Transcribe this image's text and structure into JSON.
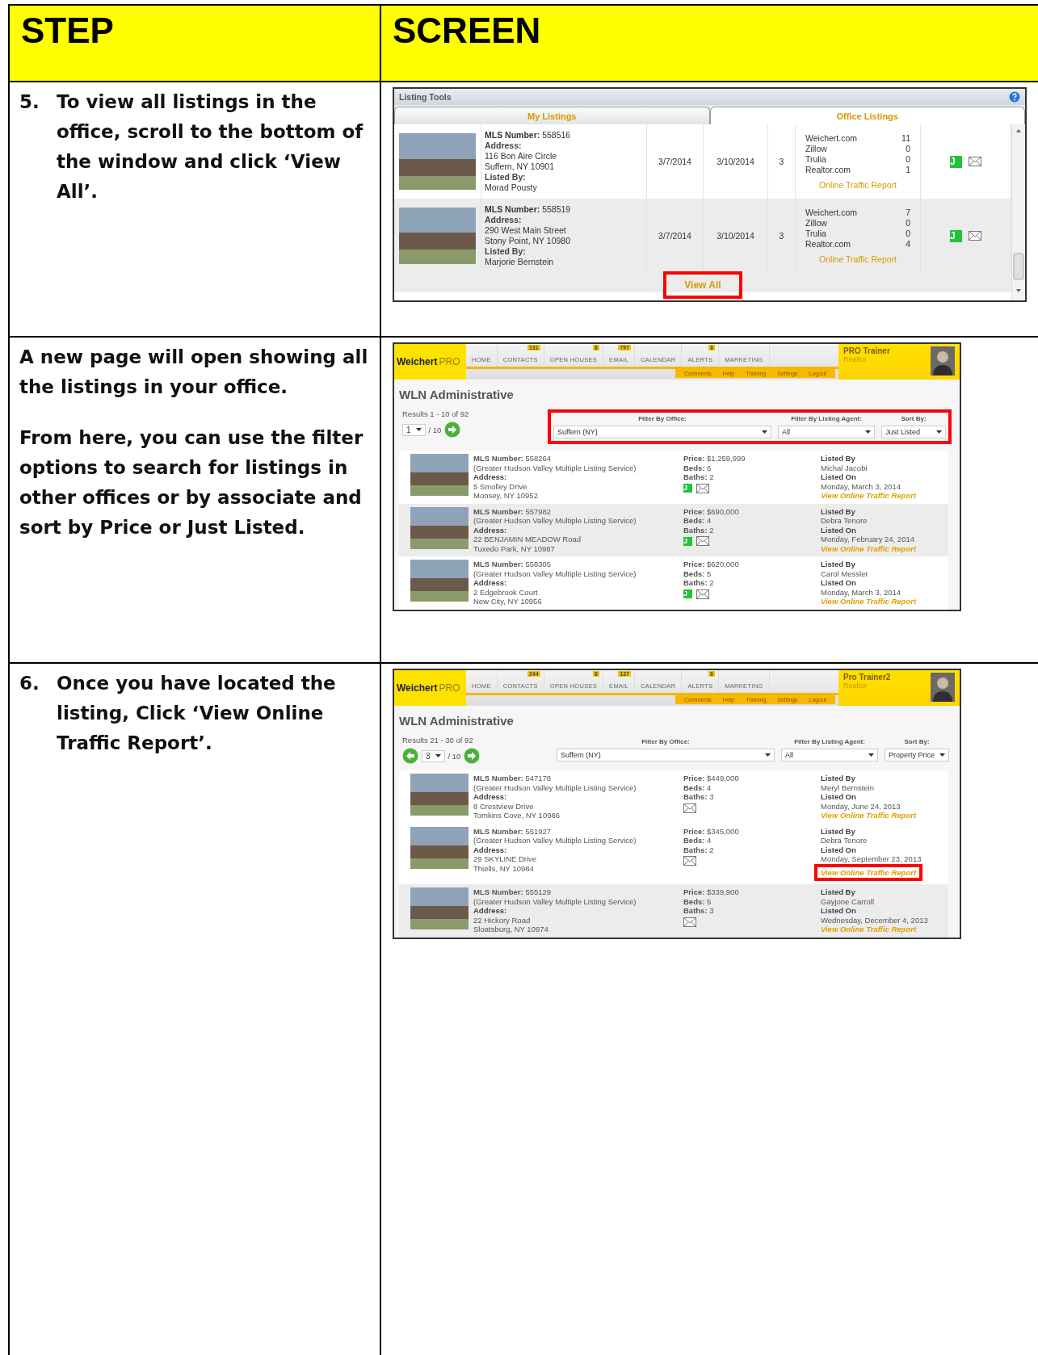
{
  "header": {
    "step": "STEP",
    "screen": "SCREEN"
  },
  "rows": [
    {
      "paragraphs": [
        {
          "number": "5.",
          "text": "To view all listings in the office, scroll to the bottom of the window and click ‘View All’."
        }
      ],
      "screen": {
        "kind": "listing_tools",
        "title": "Listing Tools",
        "tabs": [
          {
            "label": "My Listings",
            "selected": false
          },
          {
            "label": "Office Listings",
            "selected": true
          }
        ],
        "listings": [
          {
            "info": [
              {
                "kind": "field",
                "text": "**MLS Number:** 558516"
              },
              {
                "kind": "label",
                "text": "Address:"
              },
              {
                "kind": "value",
                "text": "116 Bon Aire Circle"
              },
              {
                "kind": "value",
                "text": "Suffern, NY 10901"
              },
              {
                "kind": "label",
                "text": "Listed By:"
              },
              {
                "kind": "value",
                "text": "Morad Pousty"
              }
            ],
            "date_1": "3/7/2014",
            "date_2": "3/10/2014",
            "count": "3",
            "traffic": [
              {
                "site": "Weichert.com",
                "count": "11"
              },
              {
                "site": "Zillow",
                "count": "0"
              },
              {
                "site": "Trulia",
                "count": "0"
              },
              {
                "site": "Realtor.com",
                "count": "1"
              }
            ],
            "report_link": "Online Traffic Report",
            "badge": "J",
            "shaded": false
          },
          {
            "info": [
              {
                "kind": "field",
                "text": "**MLS Number:** 558519"
              },
              {
                "kind": "label",
                "text": "Address:"
              },
              {
                "kind": "value",
                "text": "290 West Main Street"
              },
              {
                "kind": "value",
                "text": "Stony Point, NY 10980"
              },
              {
                "kind": "label",
                "text": "Listed By:"
              },
              {
                "kind": "value",
                "text": "Marjorie Bernstein"
              }
            ],
            "date_1": "3/7/2014",
            "date_2": "3/10/2014",
            "count": "3",
            "traffic": [
              {
                "site": "Weichert.com",
                "count": "7"
              },
              {
                "site": "Zillow",
                "count": "0"
              },
              {
                "site": "Trulia",
                "count": "0"
              },
              {
                "site": "Realtor.com",
                "count": "4"
              }
            ],
            "report_link": "Online Traffic Report",
            "badge": "J",
            "shaded": true
          }
        ],
        "view_all": {
          "label": "View All",
          "highlighted": true
        }
      }
    },
    {
      "paragraphs": [
        {
          "text": "A new page will open showing all the listings in your office."
        },
        {
          "text": "From here, you can use the filter options to search for listings in other offices or by associate and sort by Price or Just Listed."
        }
      ],
      "screen": {
        "kind": "listings_page",
        "logo": {
          "brand": "Weichert",
          "suffix": "PRO"
        },
        "nav": [
          {
            "label": "HOME"
          },
          {
            "label": "CONTACTS",
            "badge": "131"
          },
          {
            "label": "OPEN HOUSES",
            "badge": "8"
          },
          {
            "label": "EMAIL",
            "badge": "797"
          },
          {
            "label": "CALENDAR"
          },
          {
            "label": "ALERTS",
            "badge": "8"
          },
          {
            "label": "MARKETING"
          }
        ],
        "subnav": [
          "Comments",
          "Help",
          "Training",
          "Settings",
          "Logout"
        ],
        "user": {
          "name": "PRO Trainer",
          "role": "Realtor"
        },
        "title": "WLN Administrative",
        "results": "Results 1 - 10 of 92",
        "has_prev": false,
        "page": "1",
        "pages": "/ 10",
        "filters_highlighted": true,
        "filters": [
          {
            "label": "Filter By Office:",
            "value": "Suffern (NY)"
          },
          {
            "label": "Filter By Listing Agent:",
            "value": "All"
          },
          {
            "label": "Sort By:",
            "value": "Just Listed"
          }
        ],
        "listings": [
          {
            "info": [
              {
                "kind": "field",
                "text": "**MLS Number:** 558264"
              },
              {
                "kind": "value",
                "text": "(Greater Hudson Valley Multiple Listing Service)"
              },
              {
                "kind": "label",
                "text": "Address:"
              },
              {
                "kind": "value",
                "text": "5 Smolley Drive"
              },
              {
                "kind": "value",
                "text": "Monsey, NY 10952"
              }
            ],
            "facts": [
              "**Price:** $1,259,999",
              "**Beds:** 6",
              "**Baths:** 2"
            ],
            "badge": "J",
            "listed_by_label": "Listed By",
            "listed_by": "Michal Jacobi",
            "listed_on_label": "Listed On",
            "listed_on": "Monday, March 3, 2014",
            "report_link": "View Online Traffic Report",
            "highlighted": false,
            "shaded": false
          },
          {
            "info": [
              {
                "kind": "field",
                "text": "**MLS Number:** 557982"
              },
              {
                "kind": "value",
                "text": "(Greater Hudson Valley Multiple Listing Service)"
              },
              {
                "kind": "label",
                "text": "Address:"
              },
              {
                "kind": "value",
                "text": "22 BENJAMIN MEADOW Road"
              },
              {
                "kind": "value",
                "text": "Tuxedo Park, NY 10987"
              }
            ],
            "facts": [
              "**Price:** $690,000",
              "**Beds:** 4",
              "**Baths:** 2"
            ],
            "badge": "J",
            "listed_by_label": "Listed By",
            "listed_by": "Debra Tenore",
            "listed_on_label": "Listed On",
            "listed_on": "Monday, February 24, 2014",
            "report_link": "View Online Traffic Report",
            "highlighted": false,
            "shaded": true
          },
          {
            "info": [
              {
                "kind": "field",
                "text": "**MLS Number:** 558305"
              },
              {
                "kind": "value",
                "text": "(Greater Hudson Valley Multiple Listing Service)"
              },
              {
                "kind": "label",
                "text": "Address:"
              },
              {
                "kind": "value",
                "text": "2 Edgebrook Court"
              },
              {
                "kind": "value",
                "text": "New City, NY 10956"
              }
            ],
            "facts": [
              "**Price:** $620,000",
              "**Beds:** 5",
              "**Baths:** 2"
            ],
            "badge": "J",
            "listed_by_label": "Listed By",
            "listed_by": "Carol Messler",
            "listed_on_label": "Listed On",
            "listed_on": "Monday, March 3, 2014",
            "report_link": "View Online Traffic Report",
            "highlighted": false,
            "shaded": false
          }
        ]
      }
    },
    {
      "paragraphs": [
        {
          "number": "6.",
          "text": "Once you have located the listing, Click ‘View Online Traffic Report’."
        }
      ],
      "screen": {
        "kind": "listings_page",
        "logo": {
          "brand": "Weichert",
          "suffix": "PRO"
        },
        "nav": [
          {
            "label": "HOME"
          },
          {
            "label": "CONTACTS",
            "badge": "244"
          },
          {
            "label": "OPEN HOUSES",
            "badge": "8"
          },
          {
            "label": "EMAIL",
            "badge": "137"
          },
          {
            "label": "CALENDAR"
          },
          {
            "label": "ALERTS",
            "badge": "8"
          },
          {
            "label": "MARKETING"
          }
        ],
        "subnav": [
          "Comments",
          "Help",
          "Training",
          "Settings",
          "Logout"
        ],
        "user": {
          "name": "Pro Trainer2",
          "role": "Realtor"
        },
        "title": "WLN Administrative",
        "results": "Results 21 - 30 of 92",
        "has_prev": true,
        "page": "3",
        "pages": "/ 10",
        "filters_highlighted": false,
        "filters": [
          {
            "label": "Filter By Office:",
            "value": "Suffern (NY)"
          },
          {
            "label": "Filter By Listing Agent:",
            "value": "All"
          },
          {
            "label": "Sort By:",
            "value": "Property Price"
          }
        ],
        "listings": [
          {
            "info": [
              {
                "kind": "field",
                "text": "**MLS Number:** 547178"
              },
              {
                "kind": "value",
                "text": "(Greater Hudson Valley Multiple Listing Service)"
              },
              {
                "kind": "label",
                "text": "Address:"
              },
              {
                "kind": "value",
                "text": "8 Crestview Drive"
              },
              {
                "kind": "value",
                "text": "Tomkins Cove, NY 10986"
              }
            ],
            "facts": [
              "**Price:** $449,000",
              "**Beds:** 4",
              "**Baths:** 3"
            ],
            "listed_by_label": "Listed By",
            "listed_by": "Meryl Bernstein",
            "listed_on_label": "Listed On",
            "listed_on": "Monday, June 24, 2013",
            "report_link": "View Online Traffic Report",
            "highlighted": false,
            "shaded": false
          },
          {
            "info": [
              {
                "kind": "field",
                "text": "**MLS Number:** 551927"
              },
              {
                "kind": "value",
                "text": "(Greater Hudson Valley Multiple Listing Service)"
              },
              {
                "kind": "label",
                "text": "Address:"
              },
              {
                "kind": "value",
                "text": "29 SKYLINE Drive"
              },
              {
                "kind": "value",
                "text": "Thiells, NY 10984"
              }
            ],
            "facts": [
              "**Price:** $345,000",
              "**Beds:** 4",
              "**Baths:** 2"
            ],
            "listed_by_label": "Listed By",
            "listed_by": "Debra Tenore",
            "listed_on_label": "Listed On",
            "listed_on": "Monday, September 23, 2013",
            "report_link": "View Online Traffic Report",
            "highlighted": true,
            "shaded": false
          },
          {
            "info": [
              {
                "kind": "field",
                "text": "**MLS Number:** 555129"
              },
              {
                "kind": "value",
                "text": "(Greater Hudson Valley Multiple Listing Service)"
              },
              {
                "kind": "label",
                "text": "Address:"
              },
              {
                "kind": "value",
                "text": "22 Hickory Road"
              },
              {
                "kind": "value",
                "text": "Sloatsburg, NY 10974"
              }
            ],
            "facts": [
              "**Price:** $339,900",
              "**Beds:** 5",
              "**Baths:** 3"
            ],
            "listed_by_label": "Listed By",
            "listed_by": "Gayjone Carroll",
            "listed_on_label": "Listed On",
            "listed_on": "Wednesday, December 4, 2013",
            "report_link": "View Online Traffic Report",
            "highlighted": false,
            "shaded": true
          }
        ]
      }
    }
  ]
}
